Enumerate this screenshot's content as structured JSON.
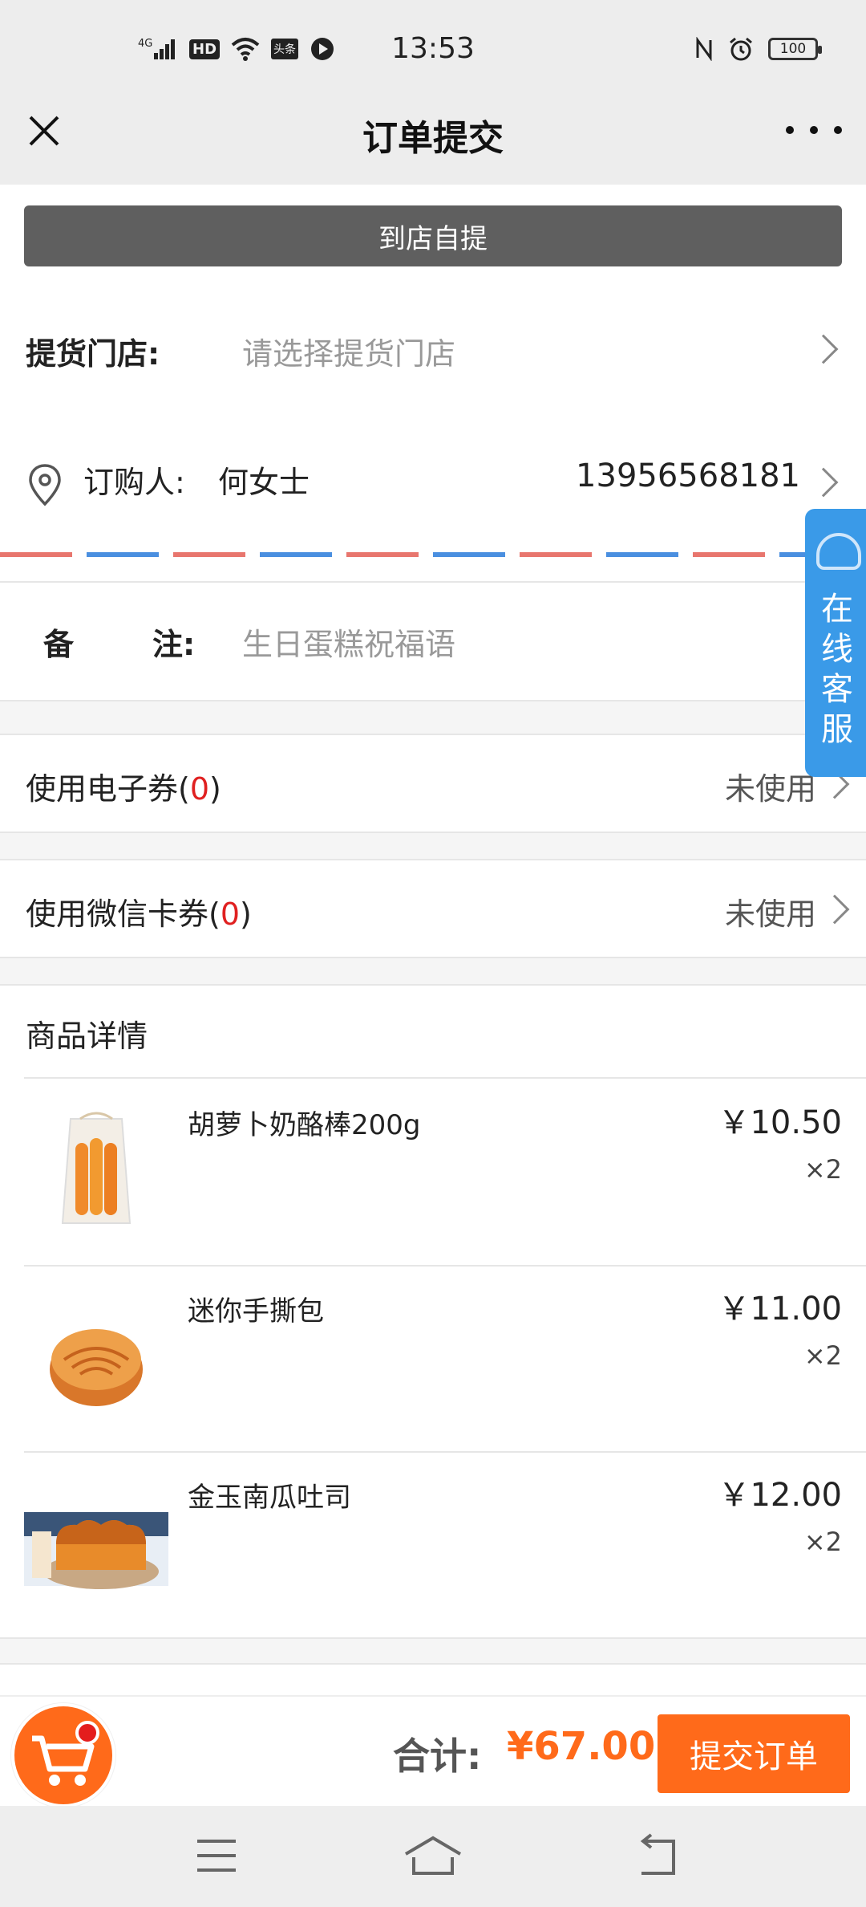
{
  "status_bar": {
    "time": "13:53",
    "left_icons": [
      "4G-signal-icon",
      "hd-icon",
      "wifi-icon",
      "toutiao-icon",
      "play-icon"
    ],
    "toutiao_text": "头条",
    "hd_text": "HD",
    "battery": "100"
  },
  "header": {
    "title": "订单提交"
  },
  "pickup": {
    "banner_label": "到店自提",
    "store_label": "提货门店:",
    "store_placeholder": "请选择提货门店"
  },
  "buyer": {
    "label": "订购人:",
    "name": "何女士",
    "phone": "13956568181"
  },
  "remark": {
    "label_part1": "备",
    "label_part2": "注:",
    "value": "生日蛋糕祝福语"
  },
  "coupons": [
    {
      "label": "使用电子券(",
      "count": "0",
      "suffix": ")",
      "state": "未使用"
    },
    {
      "label": "使用微信卡券(",
      "count": "0",
      "suffix": ")",
      "state": "未使用"
    }
  ],
  "goods": {
    "header": "商品详情",
    "items": [
      {
        "name": "胡萝卜奶酪棒200g",
        "price": "￥10.50",
        "qty": "×2"
      },
      {
        "name": "迷你手撕包",
        "price": "￥11.00",
        "qty": "×2"
      },
      {
        "name": "金玉南瓜吐司",
        "price": "￥12.00",
        "qty": "×2"
      }
    ]
  },
  "service": {
    "text": "在线客服"
  },
  "footer": {
    "total_label": "合计:",
    "total_value": "¥67.00",
    "submit_label": "提交订单"
  },
  "colors": {
    "accent": "#ff6a1a",
    "coupon_count": "#e02020",
    "service_blue": "#3a9ae8",
    "banner_gray": "#5f5f5f"
  }
}
